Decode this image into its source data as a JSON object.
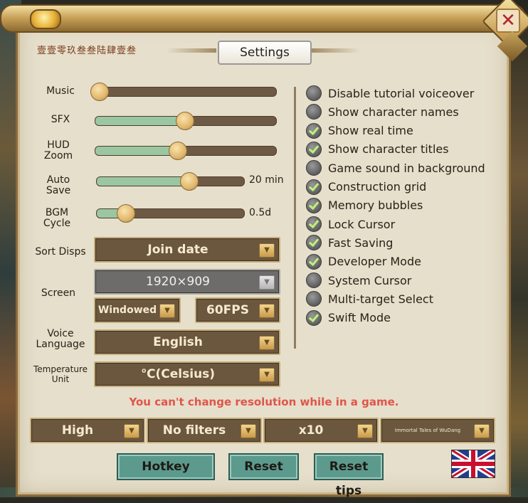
{
  "header": {
    "code_text": "壹壹零玖叁叁陆肆壹叁",
    "title": "Settings",
    "close_icon": "✕"
  },
  "sliders": [
    {
      "label": "Music",
      "value_text": "",
      "level": 0.0
    },
    {
      "label": "SFX",
      "value_text": "",
      "level": 0.49
    },
    {
      "label": "HUD\nZoom",
      "value_text": "",
      "level": 0.45
    },
    {
      "label": "Auto\nSave",
      "value_text": "20 min",
      "level": 0.63
    },
    {
      "label": "BGM\nCycle",
      "value_text": "0.5d",
      "level": 0.18
    }
  ],
  "settings": {
    "sort_disps": {
      "label": "Sort Disps",
      "value": "Join date"
    },
    "screen": {
      "label": "Screen",
      "resolution": "1920×909",
      "mode": "Windowed",
      "fps": "60FPS"
    },
    "voice_language": {
      "label": "Voice\nLanguage",
      "value": "English"
    },
    "temperature_unit": {
      "label": "Temperature\nUnit",
      "value": "℃(Celsius)"
    }
  },
  "options": [
    {
      "label": "Disable tutorial voiceover",
      "checked": false
    },
    {
      "label": "Show character names",
      "checked": false
    },
    {
      "label": "Show real time",
      "checked": true
    },
    {
      "label": "Show character titles",
      "checked": true
    },
    {
      "label": "Game sound in background",
      "checked": false
    },
    {
      "label": "Construction grid",
      "checked": true
    },
    {
      "label": "Memory bubbles",
      "checked": true
    },
    {
      "label": "Lock Cursor",
      "checked": true
    },
    {
      "label": "Fast Saving",
      "checked": true
    },
    {
      "label": "Developer Mode",
      "checked": true
    },
    {
      "label": "System Cursor",
      "checked": false
    },
    {
      "label": "Multi-target Select",
      "checked": false
    },
    {
      "label": "Swift Mode",
      "checked": true
    }
  ],
  "warning": "You can't change resolution while in a game.",
  "bottom_dropdowns": [
    "High",
    "No filters",
    "x10",
    "Immortal Tales of WuDang"
  ],
  "buttons": {
    "hotkey": "Hotkey",
    "reset": "Reset",
    "reset_tips": "Reset tips"
  },
  "language_flag_icon": "uk-flag-icon",
  "colors": {
    "panel": "#e6dfcb",
    "slider_fill": "#9bc7a0",
    "warning": "#e0554a",
    "button": "#5c9a8e"
  }
}
